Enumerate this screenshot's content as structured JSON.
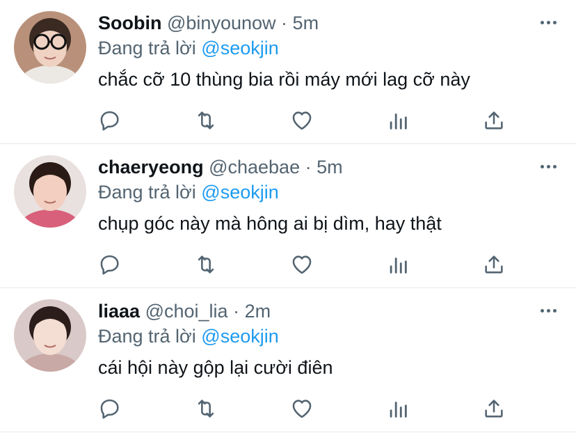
{
  "tweets": [
    {
      "name": "Soobin",
      "handle": "@binyounow",
      "separator": "·",
      "time": "5m",
      "reply_prefix": "Đang trả lời",
      "reply_to": "@seokjin",
      "text": "chắc cỡ 10 thùng bia rồi máy mới lag cỡ này",
      "avatar": {
        "bg": "#b9917a",
        "skin": "#f0d2c2",
        "hair": "#3a2a22",
        "shirt": "#ece8e4",
        "glasses": true
      }
    },
    {
      "name": "chaeryeong",
      "handle": "@chaebae",
      "separator": "·",
      "time": "5m",
      "reply_prefix": "Đang trả lời",
      "reply_to": "@seokjin",
      "text": "chụp góc này mà hông ai bị dìm, hay thật",
      "avatar": {
        "bg": "#e9e1df",
        "skin": "#f2cfc0",
        "hair": "#2a1a16",
        "shirt": "#d8607a",
        "glasses": false
      }
    },
    {
      "name": "liaaa",
      "handle": "@choi_lia",
      "separator": "·",
      "time": "2m",
      "reply_prefix": "Đang trả lời",
      "reply_to": "@seokjin",
      "text": "cái hội này gộp lại cười điên",
      "avatar": {
        "bg": "#d9c9c8",
        "skin": "#f4ddd2",
        "hair": "#2b1d1a",
        "shirt": "#c9a9a6",
        "glasses": false
      }
    }
  ],
  "actions": [
    "reply-icon",
    "retweet-icon",
    "like-icon",
    "analytics-icon",
    "share-icon"
  ],
  "colors": {
    "accent": "#1d9bf0",
    "muted": "#536471",
    "text": "#0f1419",
    "divider": "#e6e9ec"
  }
}
